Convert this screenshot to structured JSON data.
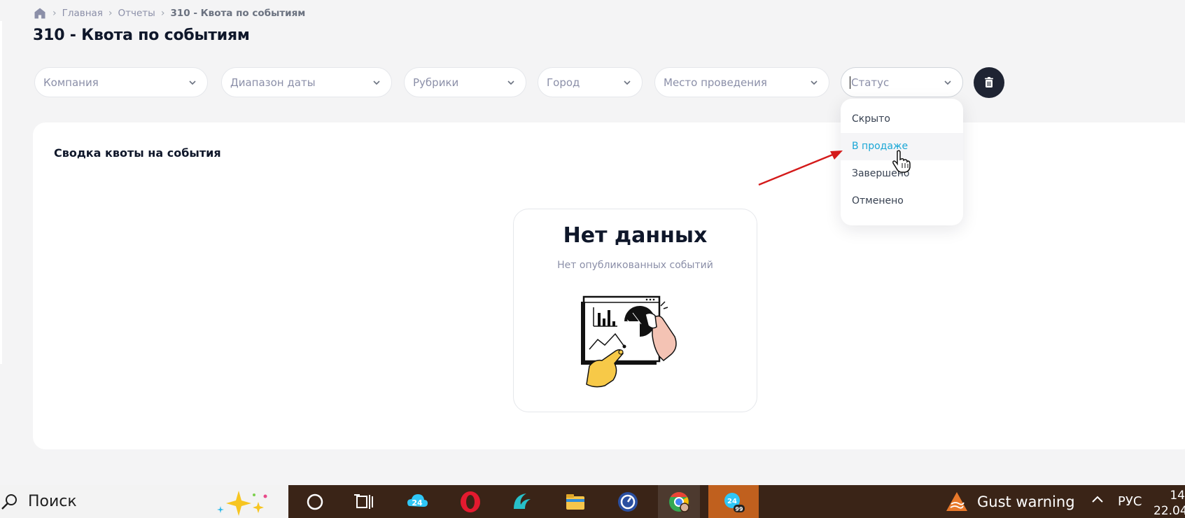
{
  "breadcrumb": {
    "home_icon": "home-icon",
    "items": [
      "Главная",
      "Отчеты",
      "310 - Квота по событиям"
    ]
  },
  "page": {
    "title": "310 - Квота по событиям"
  },
  "filters": {
    "company": "Компания",
    "date_range": "Диапазон даты",
    "categories": "Рубрики",
    "city": "Город",
    "venue": "Место проведения",
    "status": "Статус",
    "clear_icon": "trash-icon"
  },
  "status_dropdown": {
    "options": [
      "Скрыто",
      "В продаже",
      "Завершено",
      "Отменено"
    ],
    "hovered": "В продаже"
  },
  "summary": {
    "title": "Сводка квоты на события",
    "empty_title": "Нет данных",
    "empty_subtitle": "Нет опубликованных событий"
  },
  "taskbar": {
    "search_label": "Поиск",
    "weather": "Gust warning",
    "language": "РУС",
    "time": "14",
    "date": "22.04",
    "badge": "99"
  },
  "colors": {
    "accent": "#1aa7d6",
    "dark_button": "#1f2433",
    "annotation_arrow": "#d41a1a",
    "taskbar": "#3a2417"
  }
}
